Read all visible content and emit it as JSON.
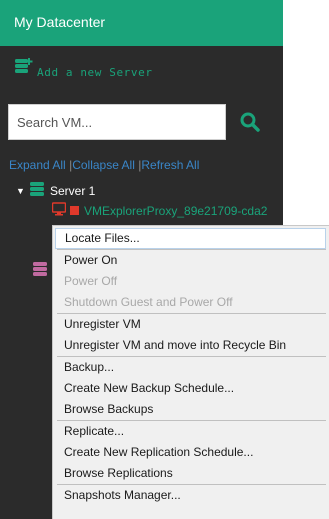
{
  "header": {
    "title": "My Datacenter"
  },
  "toolbar": {
    "add_server_label": "Add a new Server"
  },
  "search": {
    "placeholder": "Search VM..."
  },
  "tree_controls": {
    "expand_all": "Expand All",
    "collapse_all": "Collapse All",
    "refresh_all": "Refresh All",
    "separator": "|"
  },
  "tree": {
    "server_label": "Server 1",
    "vm_label": "VMExplorerProxy_89e21709-cda2"
  },
  "context_menu": {
    "items": [
      {
        "label": "Locate Files...",
        "enabled": true
      },
      {
        "label": "Power On",
        "enabled": true
      },
      {
        "label": "Power Off",
        "enabled": false
      },
      {
        "label": "Shutdown Guest and Power Off",
        "enabled": false
      },
      {
        "label": "Unregister VM",
        "enabled": true
      },
      {
        "label": "Unregister VM and move into Recycle Bin",
        "enabled": true
      },
      {
        "label": "Backup...",
        "enabled": true
      },
      {
        "label": "Create New Backup Schedule...",
        "enabled": true
      },
      {
        "label": "Browse Backups",
        "enabled": true
      },
      {
        "label": "Replicate...",
        "enabled": true
      },
      {
        "label": "Create New Replication Schedule...",
        "enabled": true
      },
      {
        "label": "Browse Replications",
        "enabled": true
      },
      {
        "label": "Snapshots Manager...",
        "enabled": true
      }
    ]
  },
  "colors": {
    "accent": "#1aa37a",
    "link": "#3a86c8",
    "sidebar_bg": "#2b2b2b",
    "vm_stopped": "#e0392b",
    "server_offline": "#c06aa0"
  }
}
